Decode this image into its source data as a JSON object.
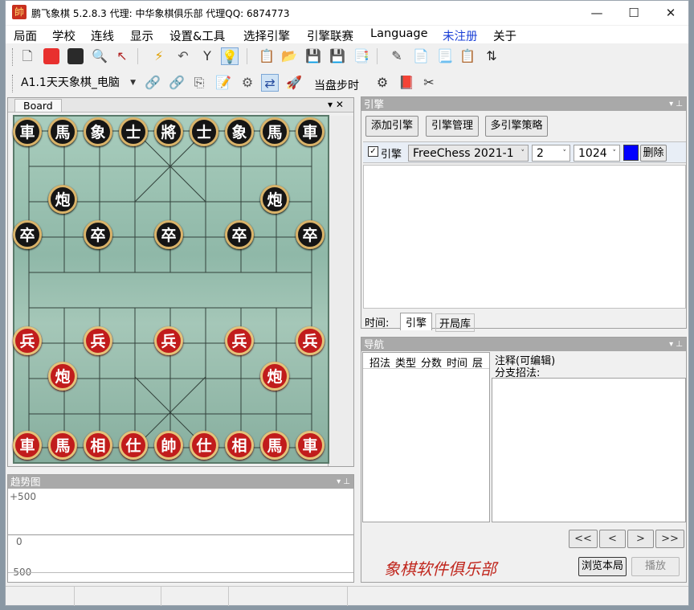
{
  "window": {
    "app_icon": "帥",
    "title": "鹏飞象棋 5.2.8.3   代理: 中华象棋俱乐部   代理QQ: 6874773",
    "minimize": "—",
    "maximize": "☐",
    "close": "✕"
  },
  "menu": [
    "局面",
    "学校",
    "连线",
    "显示",
    "设置&工具",
    "选择引擎",
    "引擎联赛",
    "Language",
    "未注册",
    "关于"
  ],
  "toolbar2": {
    "position_select": "A1.1天天象棋_电脑",
    "step_label": "当盘步时"
  },
  "board_panel": {
    "tab": "Board",
    "pin": "▾ ✕"
  },
  "pieces": {
    "black_back": [
      "車",
      "馬",
      "象",
      "士",
      "將",
      "士",
      "象",
      "馬",
      "車"
    ],
    "black_cannon": "炮",
    "black_pawn": "卒",
    "red_pawn": "兵",
    "red_cannon": "炮",
    "red_back": [
      "車",
      "馬",
      "相",
      "仕",
      "帥",
      "仕",
      "相",
      "馬",
      "車"
    ]
  },
  "trend_panel": {
    "title": "趋势图",
    "y_top": "+500",
    "y_mid": "0",
    "y_bottom": "-500"
  },
  "engine_panel": {
    "title": "引擎",
    "buttons": [
      "添加引擎",
      "引擎管理",
      "多引擎策略"
    ],
    "engine_checkbox_label": "引擎",
    "engine_name": "FreeChess  2021-1",
    "threads": "2",
    "hash": "1024",
    "color": "#0000ff",
    "delete": "删除",
    "tabs": [
      "时间:",
      "引擎",
      "开局库"
    ]
  },
  "nav_panel": {
    "title": "导航",
    "columns": [
      "招法",
      "类型",
      "分数",
      "时间",
      "层"
    ],
    "comment_label": "注释(可编辑)",
    "branch_label": "分支招法:",
    "nav_buttons": [
      "<<",
      "<",
      ">",
      ">>"
    ],
    "brand": "象棋软件俱乐部",
    "browse": "浏览本局",
    "play": "播放"
  }
}
